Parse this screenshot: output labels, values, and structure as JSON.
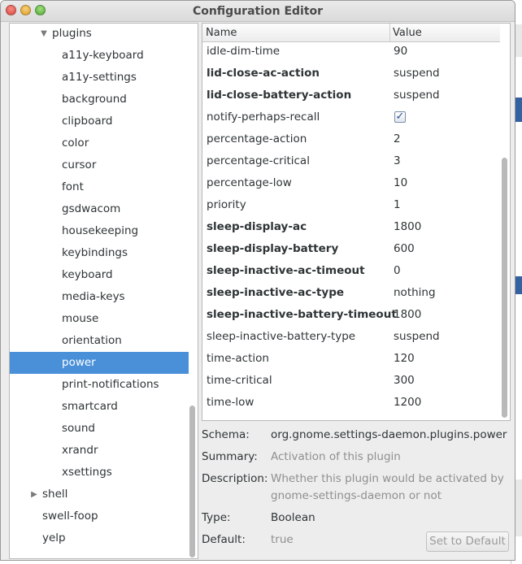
{
  "window": {
    "title": "Configuration Editor"
  },
  "tree": {
    "items": [
      {
        "label": "plugins",
        "level": 1,
        "expander": "expanded"
      },
      {
        "label": "a11y-keyboard",
        "level": 2
      },
      {
        "label": "a11y-settings",
        "level": 2
      },
      {
        "label": "background",
        "level": 2
      },
      {
        "label": "clipboard",
        "level": 2
      },
      {
        "label": "color",
        "level": 2
      },
      {
        "label": "cursor",
        "level": 2
      },
      {
        "label": "font",
        "level": 2
      },
      {
        "label": "gsdwacom",
        "level": 2
      },
      {
        "label": "housekeeping",
        "level": 2
      },
      {
        "label": "keybindings",
        "level": 2
      },
      {
        "label": "keyboard",
        "level": 2
      },
      {
        "label": "media-keys",
        "level": 2
      },
      {
        "label": "mouse",
        "level": 2
      },
      {
        "label": "orientation",
        "level": 2
      },
      {
        "label": "power",
        "level": 2,
        "selected": true
      },
      {
        "label": "print-notifications",
        "level": 2
      },
      {
        "label": "smartcard",
        "level": 2
      },
      {
        "label": "sound",
        "level": 2
      },
      {
        "label": "xrandr",
        "level": 2
      },
      {
        "label": "xsettings",
        "level": 2
      },
      {
        "label": "shell",
        "level": 0,
        "expander": "collapsed"
      },
      {
        "label": "swell-foop",
        "level": 0
      },
      {
        "label": "yelp",
        "level": 0
      }
    ]
  },
  "keys": {
    "columns": {
      "name": "Name",
      "value": "Value"
    },
    "rows": [
      {
        "name": "idle-dim-time",
        "value": "90",
        "bold": false
      },
      {
        "name": "lid-close-ac-action",
        "value": "suspend",
        "bold": true
      },
      {
        "name": "lid-close-battery-action",
        "value": "suspend",
        "bold": true
      },
      {
        "name": "notify-perhaps-recall",
        "value": "",
        "checked": true,
        "bold": false
      },
      {
        "name": "percentage-action",
        "value": "2",
        "bold": false
      },
      {
        "name": "percentage-critical",
        "value": "3",
        "bold": false
      },
      {
        "name": "percentage-low",
        "value": "10",
        "bold": false
      },
      {
        "name": "priority",
        "value": "1",
        "bold": false
      },
      {
        "name": "sleep-display-ac",
        "value": "1800",
        "bold": true
      },
      {
        "name": "sleep-display-battery",
        "value": "600",
        "bold": true
      },
      {
        "name": "sleep-inactive-ac-timeout",
        "value": "0",
        "bold": true
      },
      {
        "name": "sleep-inactive-ac-type",
        "value": "nothing",
        "bold": true
      },
      {
        "name": "sleep-inactive-battery-timeout",
        "value": "1800",
        "bold": true
      },
      {
        "name": "sleep-inactive-battery-type",
        "value": "suspend",
        "bold": false
      },
      {
        "name": "time-action",
        "value": "120",
        "bold": false
      },
      {
        "name": "time-critical",
        "value": "300",
        "bold": false
      },
      {
        "name": "time-low",
        "value": "1200",
        "bold": false
      }
    ]
  },
  "details": {
    "schema_label": "Schema:",
    "schema_value": "org.gnome.settings-daemon.plugins.power",
    "summary_label": "Summary:",
    "summary_value": "Activation of this plugin",
    "description_label": "Description:",
    "description_line1": "Whether this plugin would be activated by",
    "description_line2": "gnome-settings-daemon or not",
    "type_label": "Type:",
    "type_value": "Boolean",
    "default_label": "Default:",
    "default_value": "true",
    "set_default_label": "Set to Default"
  },
  "colors": {
    "selection": "#4a90d9",
    "muted_text": "#8f8f8f"
  }
}
